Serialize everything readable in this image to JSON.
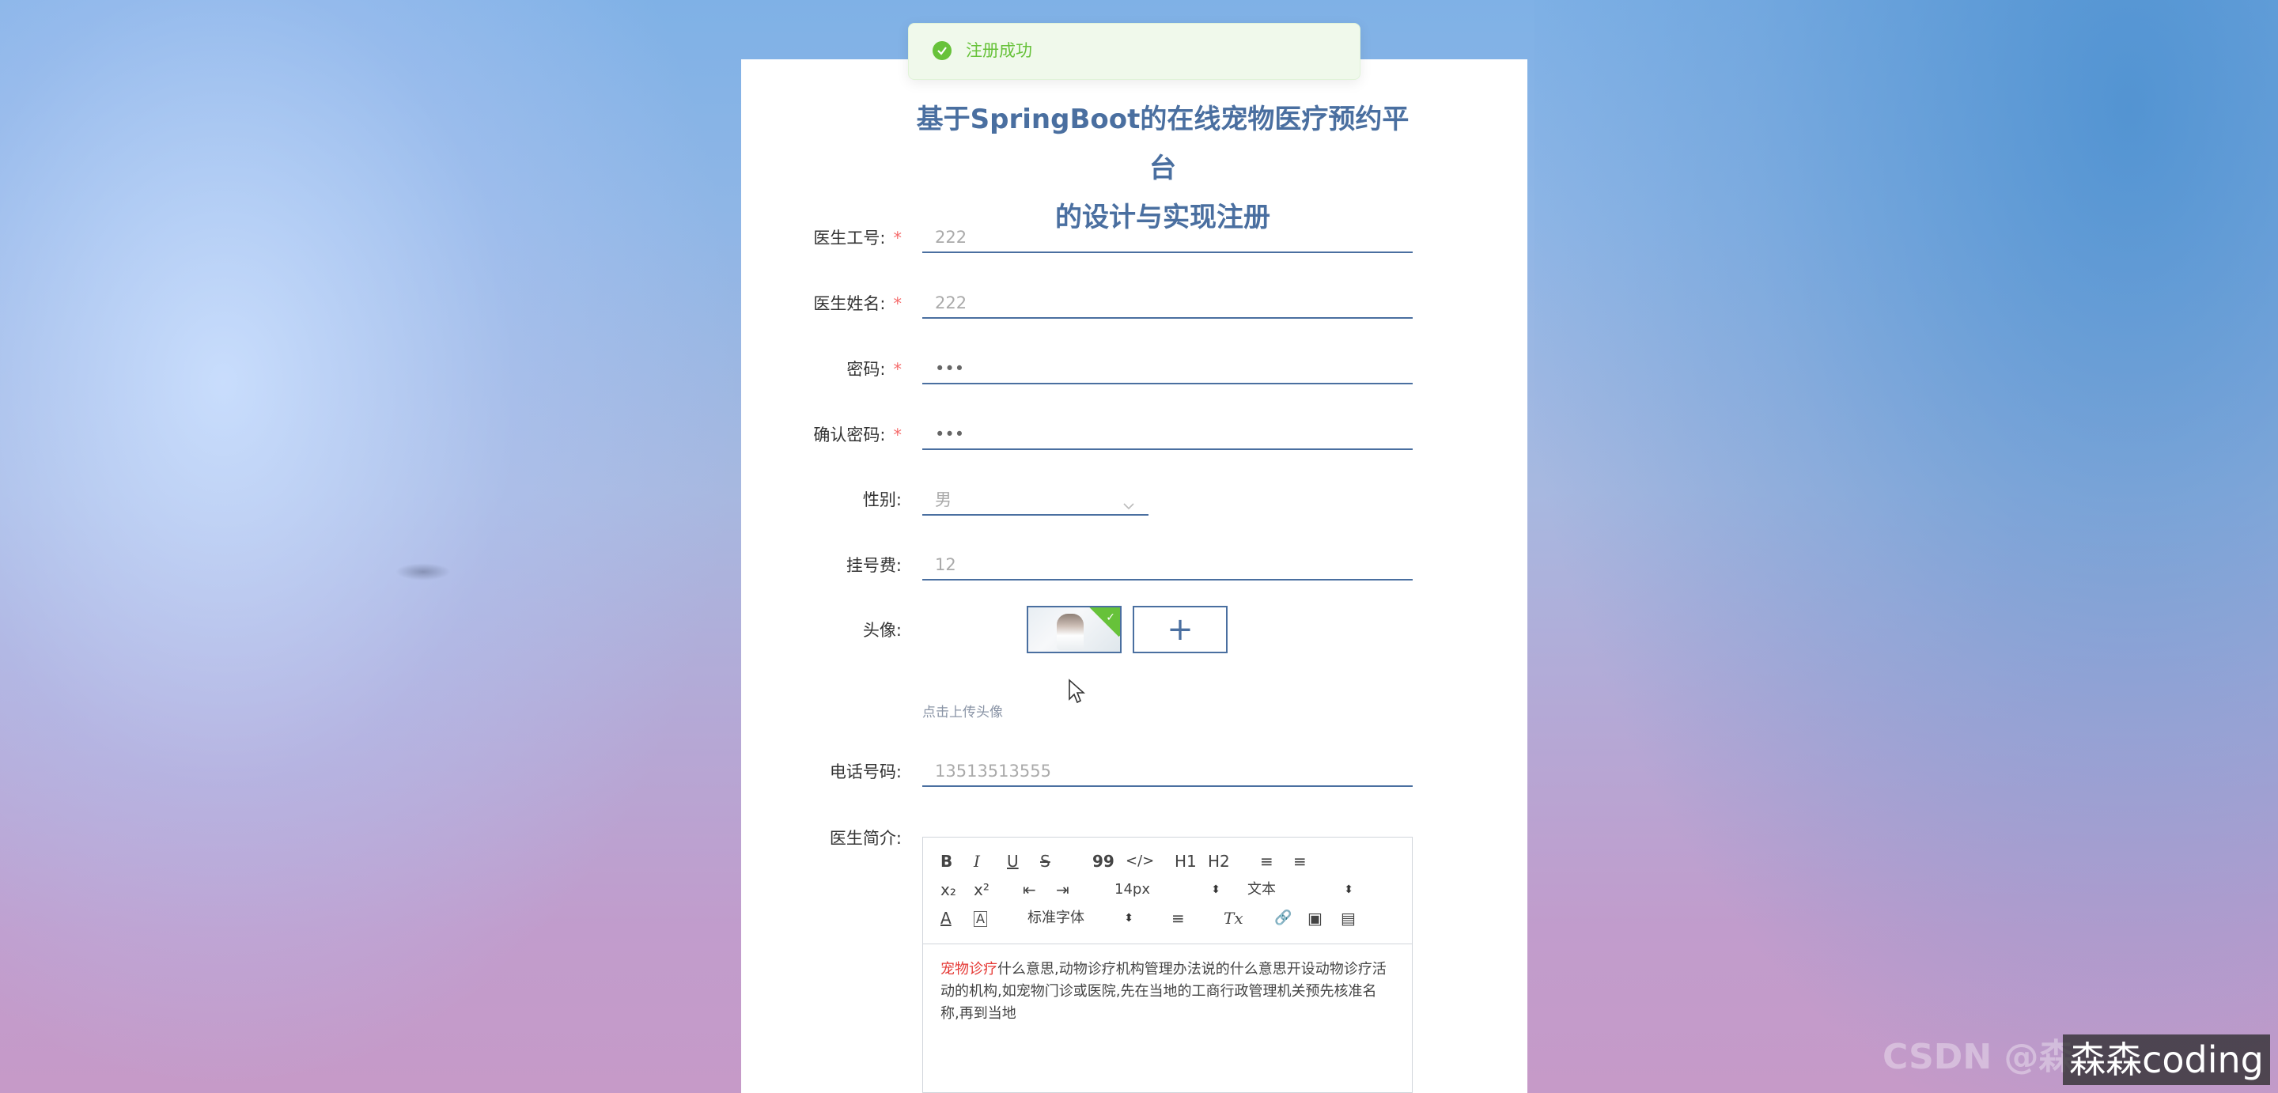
{
  "toast": {
    "message": "注册成功",
    "icon": "check-circle-icon",
    "color": "#67c23a"
  },
  "page": {
    "title_line1": "基于SpringBoot的在线宠物医疗预约平台",
    "title_line2": "的设计与实现注册"
  },
  "form": {
    "doctor_id": {
      "label": "医生工号:",
      "required_mark": "*",
      "value": "222"
    },
    "doctor_name": {
      "label": "医生姓名:",
      "required_mark": "*",
      "value": "222"
    },
    "password": {
      "label": "密码:",
      "required_mark": "*",
      "value": "•••"
    },
    "confirm_password": {
      "label": "确认密码:",
      "required_mark": "*",
      "value": "•••"
    },
    "gender": {
      "label": "性别:",
      "value": "男"
    },
    "fee": {
      "label": "挂号费:",
      "value": "12"
    },
    "avatar": {
      "label": "头像:",
      "add_icon": "+",
      "hint": "点击上传头像"
    },
    "phone": {
      "label": "电话号码:",
      "value": "13513513555"
    },
    "intro": {
      "label": "医生简介:",
      "toolbar": {
        "bold": "B",
        "italic": "I",
        "underline": "U",
        "strike": "S",
        "quote": "99",
        "code": "</>",
        "h1": "H1",
        "h2": "H2",
        "ordered_list": "≡",
        "bullet_list": "≡",
        "sub": "x₂",
        "sup": "x²",
        "outdent": "⇤",
        "indent": "⇥",
        "size": "14px",
        "header": "文本",
        "color": "A",
        "background": "A",
        "font": "标准字体",
        "align": "≡",
        "clean": "Tx",
        "link": "🔗",
        "image": "▣",
        "video": "▤"
      },
      "content_highlight": "宠物诊疗",
      "content_rest": "什么意思,动物诊疗机构管理办法说的什么意思开设动物诊疗活动的机构,如宠物门诊或医院,先在当地的工商行政管理机关预先核准名称,再到当地"
    }
  },
  "watermark": {
    "text": "森森coding",
    "faint": "CSDN @森"
  }
}
